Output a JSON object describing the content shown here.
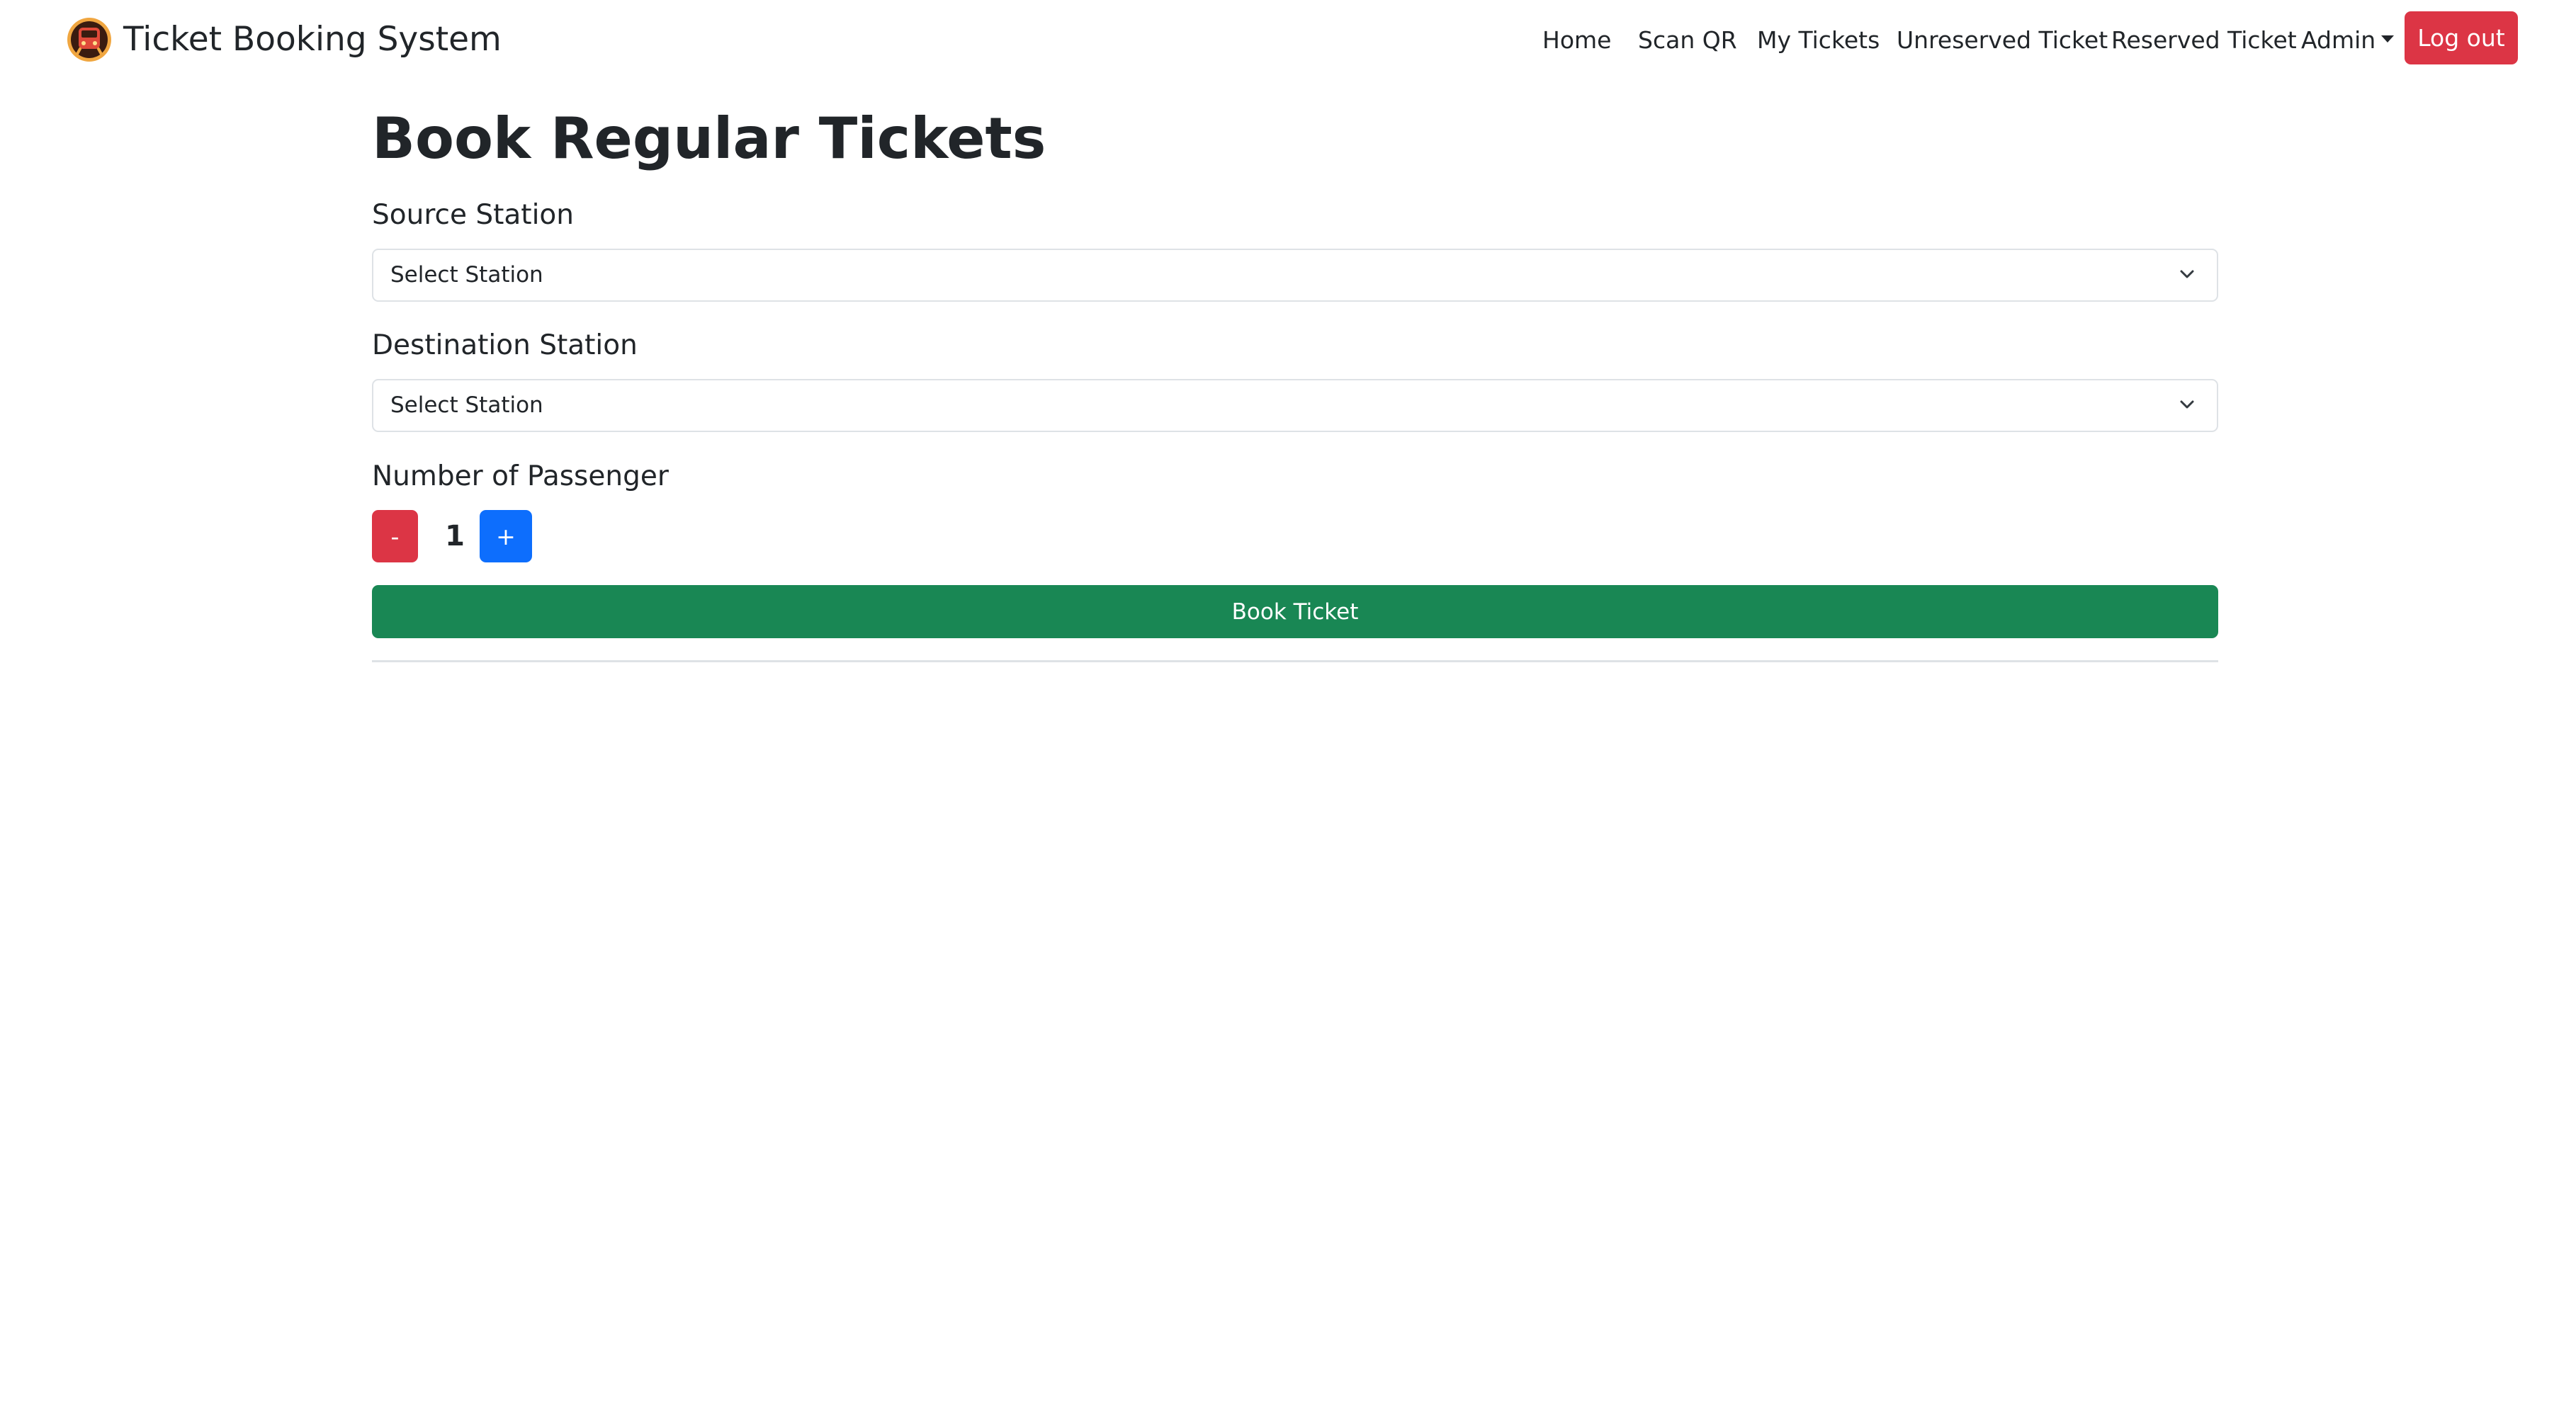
{
  "navbar": {
    "brand": "Ticket Booking System",
    "brand_icon": "train-icon",
    "links": {
      "home": "Home",
      "scan_qr": "Scan QR",
      "my_tickets": "My Tickets",
      "unreserved": "Unreserved Ticket",
      "reserved": "Reserved Ticket",
      "admin": "Admin"
    },
    "logout": "Log out"
  },
  "form": {
    "title": "Book Regular Tickets",
    "source_label": "Source Station",
    "source_value": "Select Station",
    "destination_label": "Destination Station",
    "destination_value": "Select Station",
    "passenger_label": "Number of Passenger",
    "minus": "-",
    "passenger_count": "1",
    "plus": "+",
    "submit": "Book Ticket"
  },
  "colors": {
    "danger": "#dc3545",
    "primary": "#0d6efd",
    "success": "#198754",
    "border": "#dee2e6",
    "logo_ring": "#f0a640",
    "logo_body": "#8b1a1a"
  }
}
